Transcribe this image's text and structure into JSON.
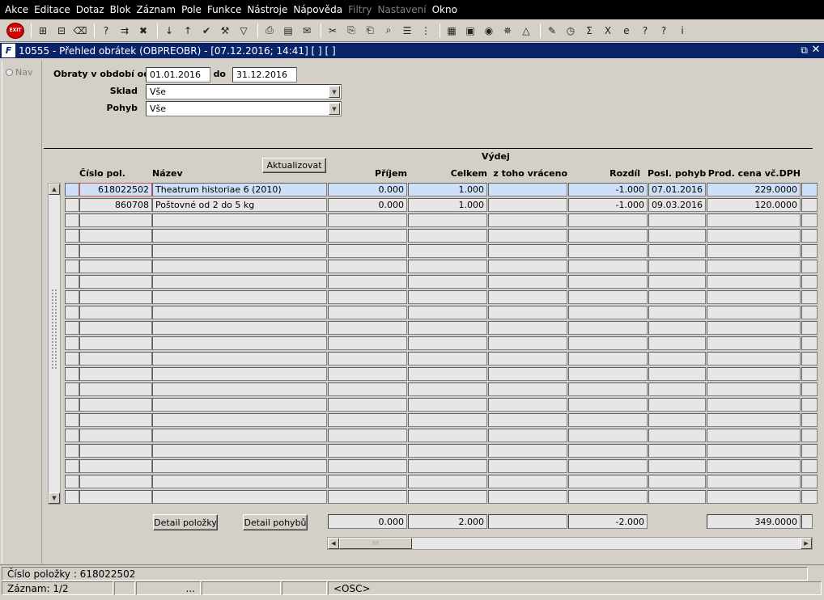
{
  "menu": [
    {
      "label": "Akce",
      "enabled": true
    },
    {
      "label": "Editace",
      "enabled": true
    },
    {
      "label": "Dotaz",
      "enabled": true
    },
    {
      "label": "Blok",
      "enabled": true
    },
    {
      "label": "Záznam",
      "enabled": true
    },
    {
      "label": "Pole",
      "enabled": true
    },
    {
      "label": "Funkce",
      "enabled": true
    },
    {
      "label": "Nástroje",
      "enabled": true
    },
    {
      "label": "Nápověda",
      "enabled": true
    },
    {
      "label": "Filtry",
      "enabled": false
    },
    {
      "label": "Nastavení",
      "enabled": false
    },
    {
      "label": "Okno",
      "enabled": true
    }
  ],
  "toolbar": {
    "exit_label": "EXIT",
    "icons": [
      {
        "name": "exit-icon",
        "glyph": "EXIT"
      },
      {
        "sep": true
      },
      {
        "name": "save-icon",
        "glyph": "⊞"
      },
      {
        "name": "print-preview-icon",
        "glyph": "⊟"
      },
      {
        "name": "clear-icon",
        "glyph": "⌫"
      },
      {
        "sep": true
      },
      {
        "name": "query-enter-icon",
        "glyph": "?"
      },
      {
        "name": "query-execute-icon",
        "glyph": "⇉"
      },
      {
        "name": "query-cancel-icon",
        "glyph": "✖"
      },
      {
        "sep": true
      },
      {
        "name": "sort-asc-icon",
        "glyph": "↓"
      },
      {
        "name": "sort-desc-icon",
        "glyph": "↑"
      },
      {
        "name": "check-icon",
        "glyph": "✔"
      },
      {
        "name": "wrench-icon",
        "glyph": "⚒"
      },
      {
        "name": "filter-icon",
        "glyph": "▽"
      },
      {
        "sep": true
      },
      {
        "name": "printer-icon",
        "glyph": "⎙"
      },
      {
        "name": "report-icon",
        "glyph": "▤"
      },
      {
        "name": "mail-icon",
        "glyph": "✉"
      },
      {
        "sep": true
      },
      {
        "name": "cut-icon",
        "glyph": "✂"
      },
      {
        "name": "copy-icon",
        "glyph": "⎘"
      },
      {
        "name": "paste-icon",
        "glyph": "⎗"
      },
      {
        "name": "find-icon",
        "glyph": "⌕"
      },
      {
        "name": "list-icon",
        "glyph": "☰"
      },
      {
        "name": "tree-icon",
        "glyph": "⋮"
      },
      {
        "sep": true
      },
      {
        "name": "calculator-icon",
        "glyph": "▦"
      },
      {
        "name": "calendar-icon",
        "glyph": "▣"
      },
      {
        "name": "globe-icon",
        "glyph": "◉"
      },
      {
        "name": "ship-wheel-icon",
        "glyph": "✵"
      },
      {
        "name": "warning-icon",
        "glyph": "△"
      },
      {
        "sep": true
      },
      {
        "name": "notes-icon",
        "glyph": "✎"
      },
      {
        "name": "clock-icon",
        "glyph": "◷"
      },
      {
        "name": "sum-icon",
        "glyph": "Σ"
      },
      {
        "name": "excel-icon",
        "glyph": "X"
      },
      {
        "name": "internet-icon",
        "glyph": "e"
      },
      {
        "name": "help-context-icon",
        "glyph": "?"
      },
      {
        "name": "help-icon",
        "glyph": "?"
      },
      {
        "name": "info-icon",
        "glyph": "i"
      }
    ]
  },
  "window": {
    "logo": "F",
    "title": "10555 - Přehled obrátek (OBPREOBR) - [07.12.2016; 14:41]  [ ]  [ ]",
    "restore_glyph": "⧉",
    "close_glyph": "✕"
  },
  "nav": {
    "label": "Nav"
  },
  "form": {
    "period_label": "Obraty v období od",
    "date_from": "01.01.2016",
    "to_label": "do",
    "date_to": "31.12.2016",
    "warehouse_label": "Sklad",
    "warehouse_value": "Vše",
    "movement_label": "Pohyb",
    "movement_value": "Vše"
  },
  "grid": {
    "group_header": "Výdej",
    "refresh_button": "Aktualizovat",
    "columns": {
      "item_no": "Číslo pol.",
      "name": "Název",
      "receipt": "Příjem",
      "total": "Celkem",
      "returned": "z toho vráceno",
      "difference": "Rozdíl",
      "last_move": "Posl. pohyb",
      "price": "Prod. cena vč.DPH"
    },
    "rows": [
      {
        "item_no": "618022502",
        "name": "Theatrum historiae 6 (2010)",
        "receipt": "0.000",
        "total": "1.000",
        "returned": "",
        "difference": "-1.000",
        "last_move": "07.01.2016",
        "price": "229.0000"
      },
      {
        "item_no": "860708",
        "name": "Poštovné od 2 do 5 kg",
        "receipt": "0.000",
        "total": "1.000",
        "returned": "",
        "difference": "-1.000",
        "last_move": "09.03.2016",
        "price": "120.0000"
      }
    ],
    "empty_rows": 19,
    "totals": {
      "receipt": "0.000",
      "total": "2.000",
      "returned": "",
      "difference": "-2.000",
      "price": "349.0000"
    }
  },
  "buttons": {
    "item_detail": "Detail položky",
    "move_detail": "Detail pohybů"
  },
  "status": {
    "field_info": "Číslo položky : 618022502",
    "record": "Záznam: 1/2",
    "ellipsis": "...",
    "mode": "<OSC>"
  }
}
